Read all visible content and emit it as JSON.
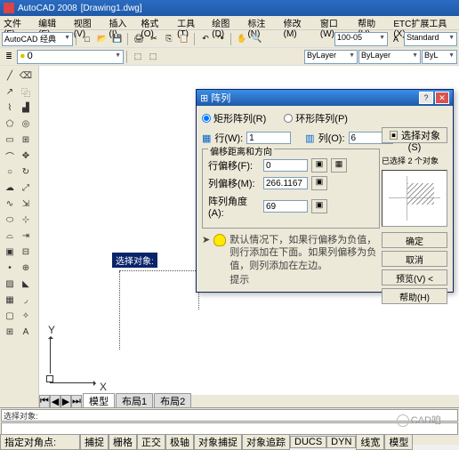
{
  "titlebar": {
    "app": "AutoCAD 2008",
    "doc": "[Drawing1.dwg]"
  },
  "menus": [
    "文件(F)",
    "编辑(E)",
    "视图(V)",
    "插入(I)",
    "格式(O)",
    "工具(T)",
    "绘图(D)",
    "标注(N)",
    "修改(M)",
    "窗口(W)",
    "帮助(H)",
    "ETC扩展工具(X)"
  ],
  "row1": {
    "ws": "AutoCAD 经典",
    "scale": "100-05",
    "style": "Standard"
  },
  "row2": {
    "layer": "0",
    "linetype": "ByLayer",
    "lineweight": "ByLayer",
    "color": "ByL"
  },
  "canvas": {
    "tooltip": "选择对象:",
    "y": "Y",
    "x": "X"
  },
  "tabs": {
    "model": "模型",
    "l1": "布局1",
    "l2": "布局2"
  },
  "cmd": {
    "prompt": "选择对象:"
  },
  "status": {
    "coords": "指定对角点:",
    "buttons": [
      "捕捉",
      "栅格",
      "正交",
      "极轴",
      "对象捕捉",
      "对象追踪",
      "DUCS",
      "DYN",
      "线宽",
      "模型"
    ]
  },
  "dialog": {
    "title": "阵列",
    "rect_array": "矩形阵列(R)",
    "polar_array": "环形阵列(P)",
    "select_btn": "选择对象(S)",
    "selected": "已选择 2 个对象",
    "rows_lbl": "行(W):",
    "rows_val": "1",
    "cols_lbl": "列(O):",
    "cols_val": "6",
    "offset_title": "偏移距离和方向",
    "row_off_lbl": "行偏移(F):",
    "row_off_val": "0",
    "col_off_lbl": "列偏移(M):",
    "col_off_val": "266.1167",
    "angle_lbl": "阵列角度(A):",
    "angle_val": "69",
    "hint_label": "提示",
    "hint": "默认情况下，如果行偏移为负值，则行添加在下面。如果列偏移为负值，则列添加在左边。",
    "ok": "确定",
    "cancel": "取消",
    "preview": "预览(V) <",
    "help": "帮助(H)"
  },
  "watermark": "CAD咱"
}
